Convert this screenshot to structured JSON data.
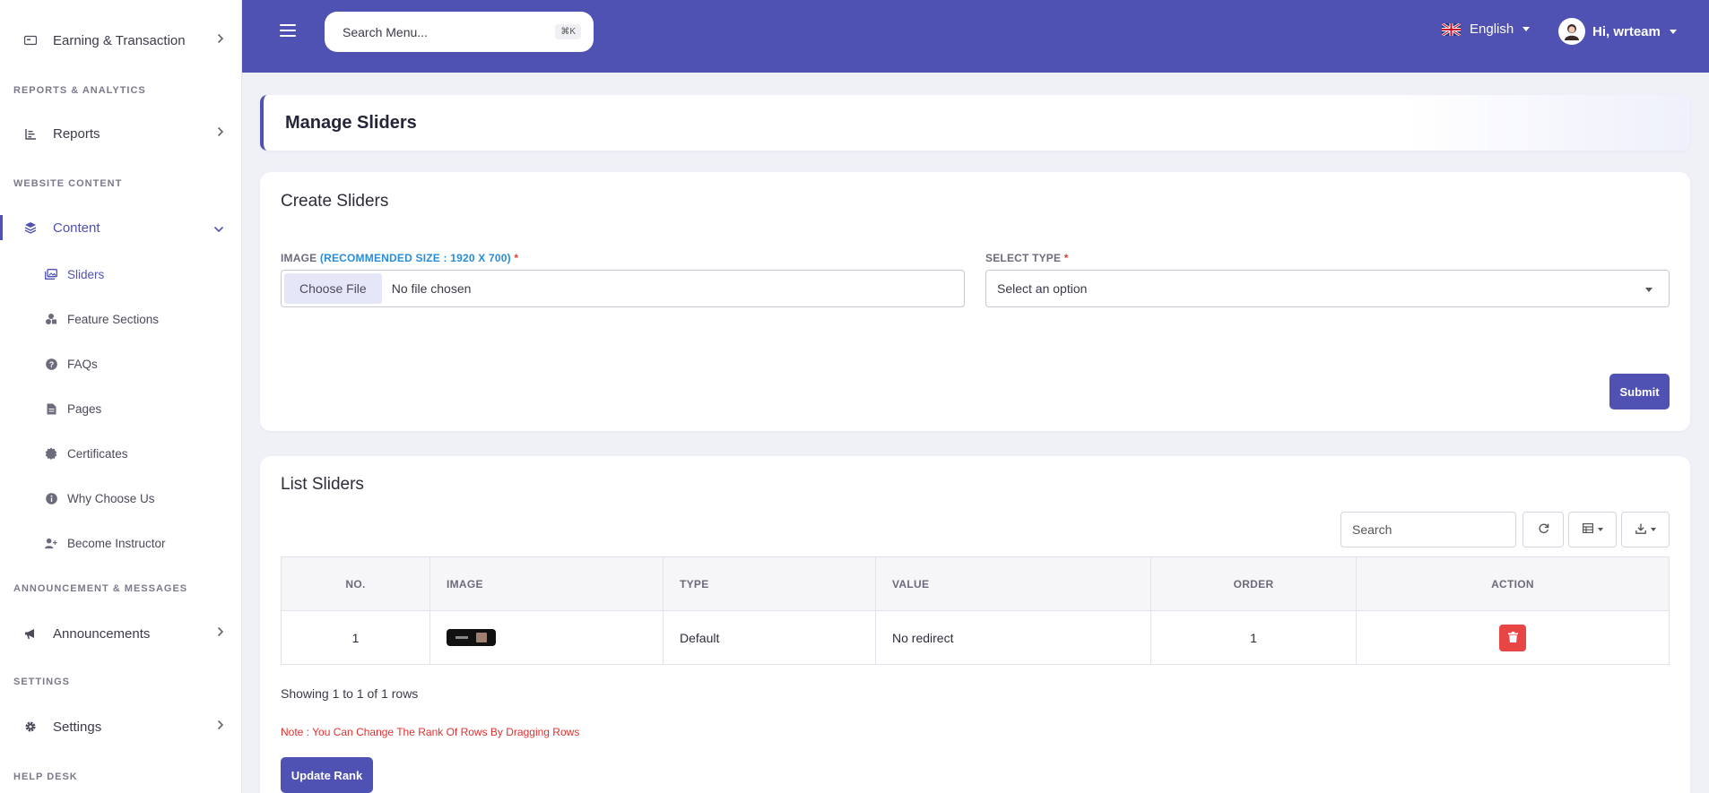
{
  "sidebar": {
    "earning": "Earning & Transaction",
    "heading_reports": "REPORTS & ANALYTICS",
    "reports": "Reports",
    "heading_website": "WEBSITE CONTENT",
    "content": "Content",
    "sub_items": [
      {
        "label": "Sliders",
        "icon": "images-icon"
      },
      {
        "label": "Feature Sections",
        "icon": "shapes-icon"
      },
      {
        "label": "FAQs",
        "icon": "question-icon"
      },
      {
        "label": "Pages",
        "icon": "file-icon"
      },
      {
        "label": "Certificates",
        "icon": "certificate-icon"
      },
      {
        "label": "Why Choose Us",
        "icon": "info-icon"
      },
      {
        "label": "Become Instructor",
        "icon": "user-plus-icon"
      }
    ],
    "heading_announce": "ANNOUNCEMENT & MESSAGES",
    "announcements": "Announcements",
    "heading_settings": "SETTINGS",
    "settings": "Settings",
    "heading_help": "HELP DESK"
  },
  "topbar": {
    "search_placeholder": "Search Menu...",
    "shortcut": "⌘K",
    "language": "English",
    "user": "Hi, wrteam"
  },
  "page": {
    "title": "Manage Sliders"
  },
  "create": {
    "title": "Create Sliders",
    "image_label": "IMAGE",
    "image_hint": "(RECOMMENDED SIZE : 1920 X 700)",
    "required": "*",
    "choose_file": "Choose File",
    "no_file": "No file chosen",
    "type_label": "SELECT TYPE",
    "type_placeholder": "Select an option",
    "submit": "Submit"
  },
  "list": {
    "title": "List Sliders",
    "search_placeholder": "Search",
    "columns": [
      "NO.",
      "IMAGE",
      "TYPE",
      "VALUE",
      "ORDER",
      "ACTION"
    ],
    "rows": [
      {
        "no": "1",
        "type": "Default",
        "value": "No redirect",
        "order": "1"
      }
    ],
    "showing": "Showing 1 to 1 of 1 rows",
    "note": "Note : You Can Change The Rank Of Rows By Dragging Rows",
    "update_rank": "Update Rank"
  },
  "colors": {
    "primary": "#4f52b2",
    "danger": "#e84545",
    "hint": "#2a8dd8"
  }
}
